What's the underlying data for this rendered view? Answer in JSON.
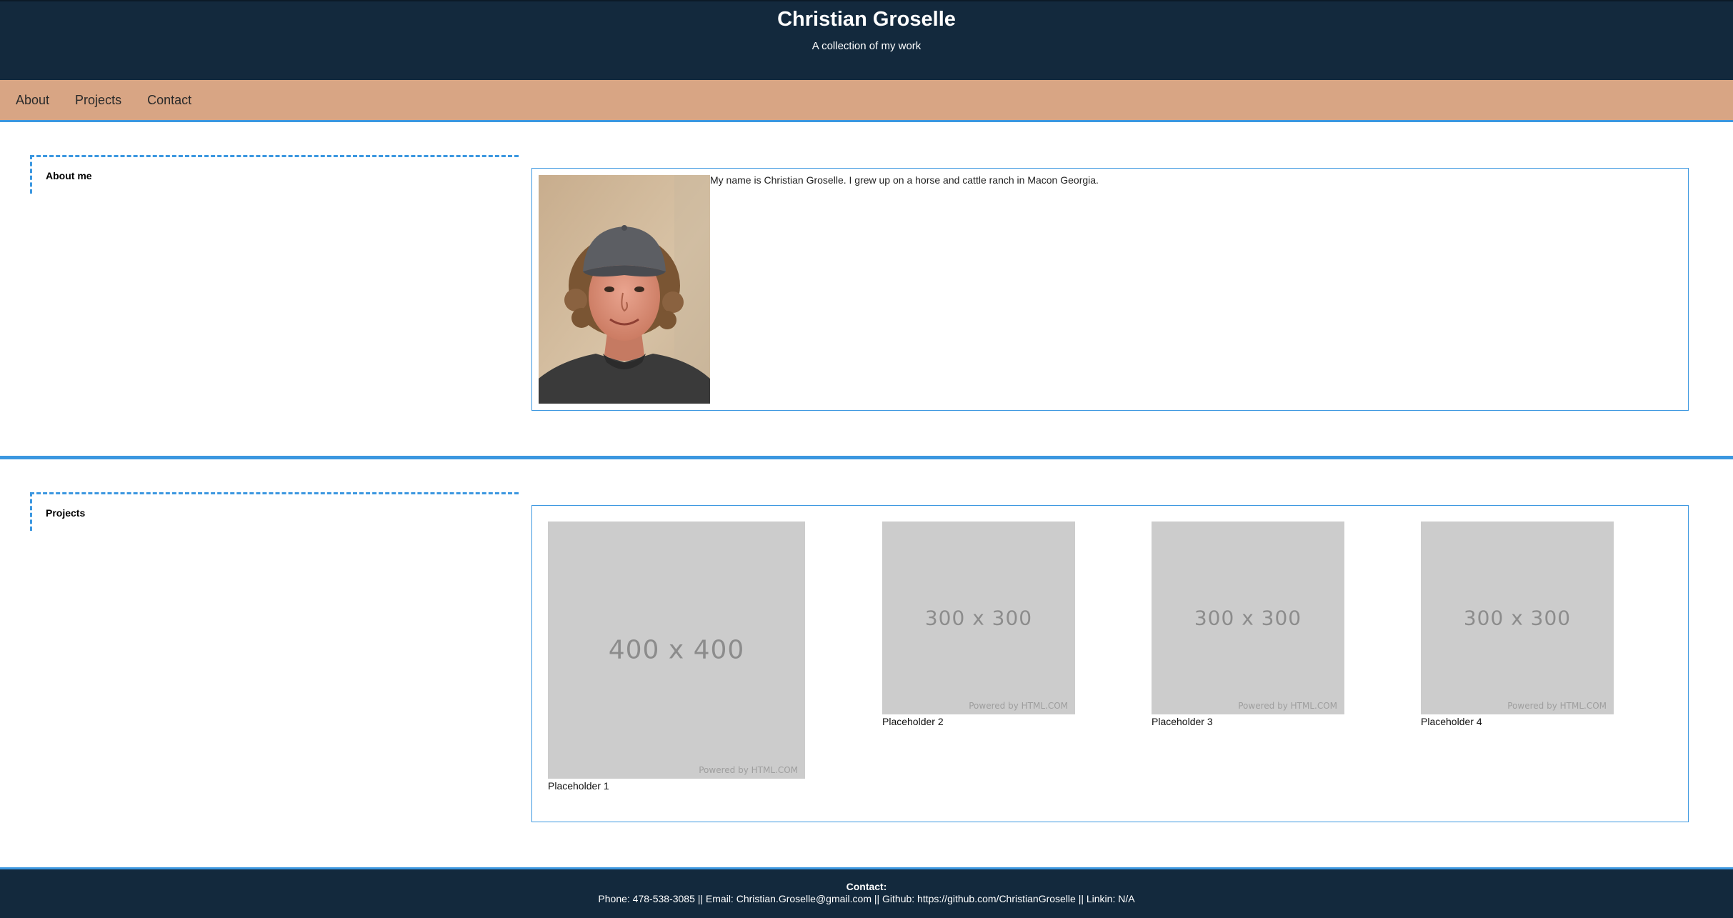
{
  "header": {
    "title": "Christian Groselle",
    "subtitle": "A collection of my work"
  },
  "nav": {
    "items": [
      {
        "label": "About"
      },
      {
        "label": "Projects"
      },
      {
        "label": "Contact"
      }
    ]
  },
  "about": {
    "heading": "About me",
    "text": "My name is Christian Groselle. I grew up on a horse and cattle ranch in Macon Georgia."
  },
  "projects": {
    "heading": "Projects",
    "items": [
      {
        "image_text": "400 x 400",
        "powered": "Powered by HTML.COM",
        "caption": "Placeholder 1"
      },
      {
        "image_text": "300 x 300",
        "powered": "Powered by HTML.COM",
        "caption": "Placeholder 2"
      },
      {
        "image_text": "300 x 300",
        "powered": "Powered by HTML.COM",
        "caption": "Placeholder 3"
      },
      {
        "image_text": "300 x 300",
        "powered": "Powered by HTML.COM",
        "caption": "Placeholder 4"
      }
    ]
  },
  "footer": {
    "title": "Contact:",
    "line": "Phone: 478-538-3085 || Email: Christian.Groselle@gmail.com || Github: https://github.com/ChristianGroselle || Linkin: N/A"
  },
  "colors": {
    "header_bg": "#13293d",
    "nav_bg": "#d8a584",
    "accent": "#3b97e0",
    "placeholder_bg": "#cccccc"
  }
}
